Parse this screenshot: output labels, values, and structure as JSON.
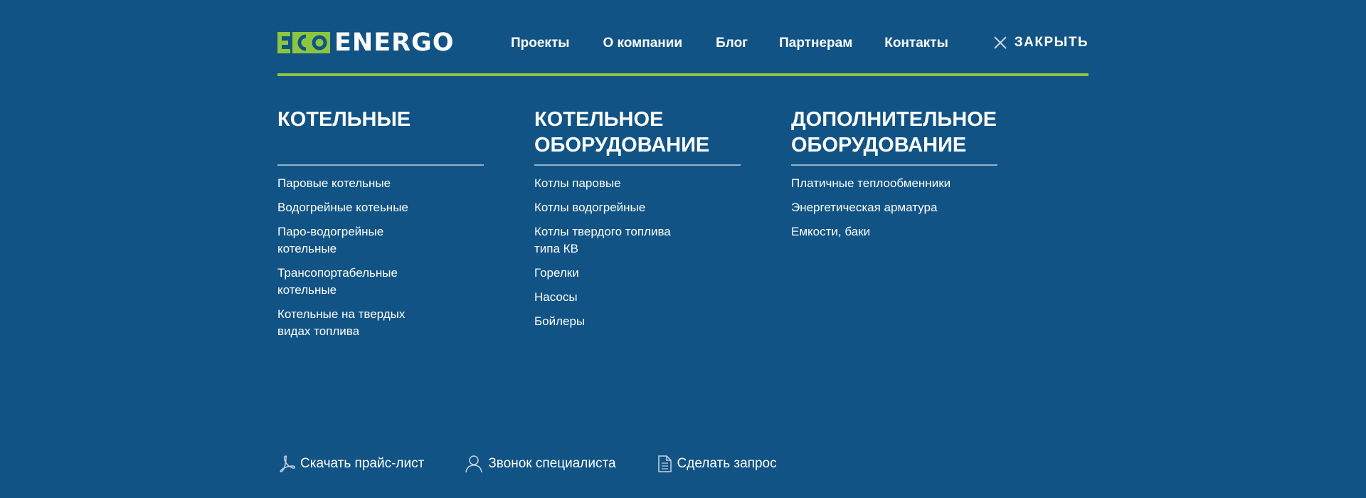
{
  "brand": {
    "logo_prefix": "ECO",
    "logo_text": "ENERGO",
    "accent_color": "#8cc63f",
    "background_color": "#115384"
  },
  "nav": {
    "items": [
      {
        "label": "Проекты"
      },
      {
        "label": "О компании"
      },
      {
        "label": "Блог"
      },
      {
        "label": "Партнерам"
      },
      {
        "label": "Контакты"
      }
    ]
  },
  "close": {
    "label": "ЗАКРЫТЬ",
    "icon": "close-icon"
  },
  "columns": [
    {
      "heading": "КОТЕЛЬНЫЕ",
      "items": [
        {
          "label": "Паровые котельные"
        },
        {
          "label": "Водогрейные котеьные"
        },
        {
          "label": "Паро-водогрейные котельные"
        },
        {
          "label": "Трансопортабельные котельные"
        },
        {
          "label": "Котельные на твердых видах топлива"
        }
      ]
    },
    {
      "heading": "КОТЕЛЬНОЕ ОБОРУДОВАНИЕ",
      "items": [
        {
          "label": "Котлы паровые"
        },
        {
          "label": "Котлы водогрейные"
        },
        {
          "label": "Котлы твердого топлива типа КВ"
        },
        {
          "label": "Горелки"
        },
        {
          "label": "Насосы"
        },
        {
          "label": "Бойлеры"
        }
      ]
    },
    {
      "heading": "ДОПОЛНИТЕЛЬНОЕ ОБОРУДОВАНИЕ",
      "items": [
        {
          "label": "Платичные теплообменники"
        },
        {
          "label": "Энергетическая арматура"
        },
        {
          "label": "Емкости, баки"
        }
      ]
    }
  ],
  "footer_links": [
    {
      "label": "Скачать прайс-лист",
      "icon": "pdf-icon"
    },
    {
      "label": "Звонок специалиста",
      "icon": "user-icon"
    },
    {
      "label": "Сделать запрос",
      "icon": "document-icon"
    }
  ]
}
